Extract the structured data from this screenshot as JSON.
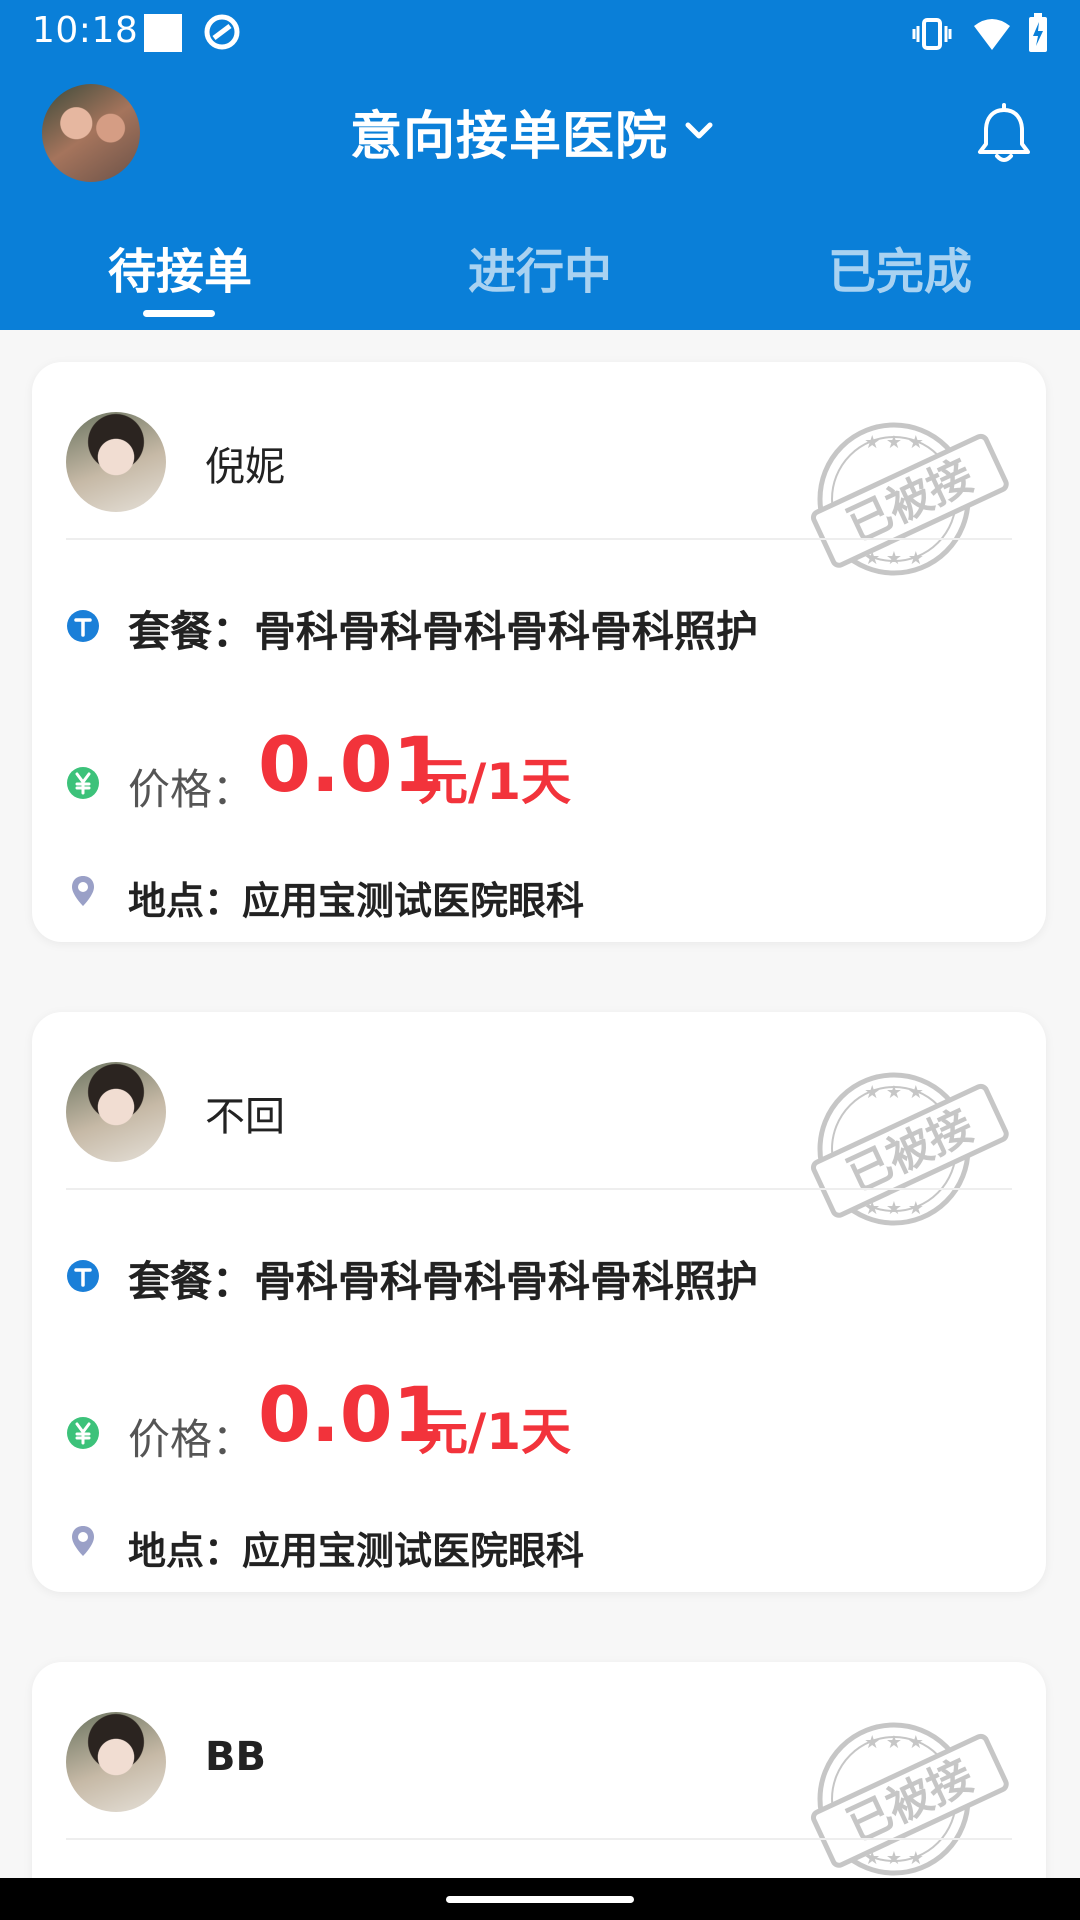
{
  "status_bar": {
    "time": "10:18"
  },
  "header": {
    "title": "意向接单医院"
  },
  "tabs": [
    {
      "label": "待接单",
      "active": true
    },
    {
      "label": "进行中",
      "active": false
    },
    {
      "label": "已完成",
      "active": false
    }
  ],
  "cards": [
    {
      "name": "倪妮",
      "stamp_text": "已被接",
      "package_label": "套餐：",
      "package_value": "骨科骨科骨科骨科骨科照护",
      "price_label": "价格：",
      "price_amount": "0.01",
      "price_unit": "元/1天",
      "location_label": "地点：",
      "location_value": "应用宝测试医院眼科"
    },
    {
      "name": "不回",
      "stamp_text": "已被接",
      "package_label": "套餐：",
      "package_value": "骨科骨科骨科骨科骨科照护",
      "price_label": "价格：",
      "price_amount": "0.01",
      "price_unit": "元/1天",
      "location_label": "地点：",
      "location_value": "应用宝测试医院眼科"
    },
    {
      "name": "BB",
      "stamp_text": "已被接"
    }
  ],
  "colors": {
    "primary": "#0a7fd8",
    "price": "#f2333b",
    "package_icon": "#1a7fd8",
    "price_icon": "#3cc27a",
    "location_icon": "#9aa0c7"
  },
  "icons": {
    "package": "t-circle-icon",
    "price": "yuan-circle-icon",
    "location": "location-pin-icon",
    "notifications": "bell-icon",
    "dropdown": "chevron-down-icon",
    "stamp": "accepted-stamp-icon"
  }
}
